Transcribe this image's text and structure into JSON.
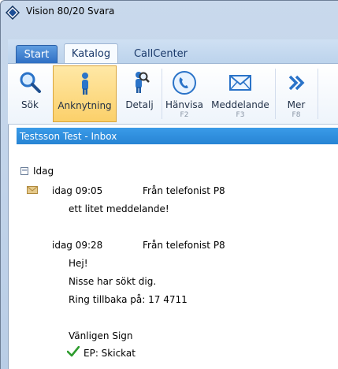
{
  "window": {
    "title": "Vision 80/20 Svara"
  },
  "tabs": [
    {
      "label": "Start"
    },
    {
      "label": "Katalog"
    },
    {
      "label": "CallCenter"
    }
  ],
  "ribbon": {
    "buttons": [
      {
        "label": "Sök",
        "key": "",
        "icon": "search-icon"
      },
      {
        "label": "Anknytning",
        "key": "",
        "icon": "person-icon"
      },
      {
        "label": "Detalj",
        "key": "",
        "icon": "person-search-icon"
      },
      {
        "label": "Hänvisa",
        "key": "F2",
        "icon": "phone-icon"
      },
      {
        "label": "Meddelande",
        "key": "F3",
        "icon": "envelope-icon"
      },
      {
        "label": "Mer",
        "key": "F8",
        "icon": "double-chevron-right-icon"
      }
    ]
  },
  "inbox": {
    "header": "Testsson Test - Inbox",
    "group": "Idag",
    "messages": [
      {
        "time": "idag 09:05",
        "from": "Från telefonist P8",
        "lines": [
          "ett litet meddelande!"
        ]
      },
      {
        "time": "idag 09:28",
        "from": "Från telefonist P8",
        "lines": [
          "Hej!",
          "Nisse har sökt dig.",
          "Ring tillbaka på: 17 4711",
          "",
          "Vänligen Sign"
        ],
        "status": "EP: Skickat"
      }
    ]
  },
  "colors": {
    "header_bg": "#2784d4",
    "active_button": "#fbd06a",
    "accent": "#1f5fb0"
  }
}
